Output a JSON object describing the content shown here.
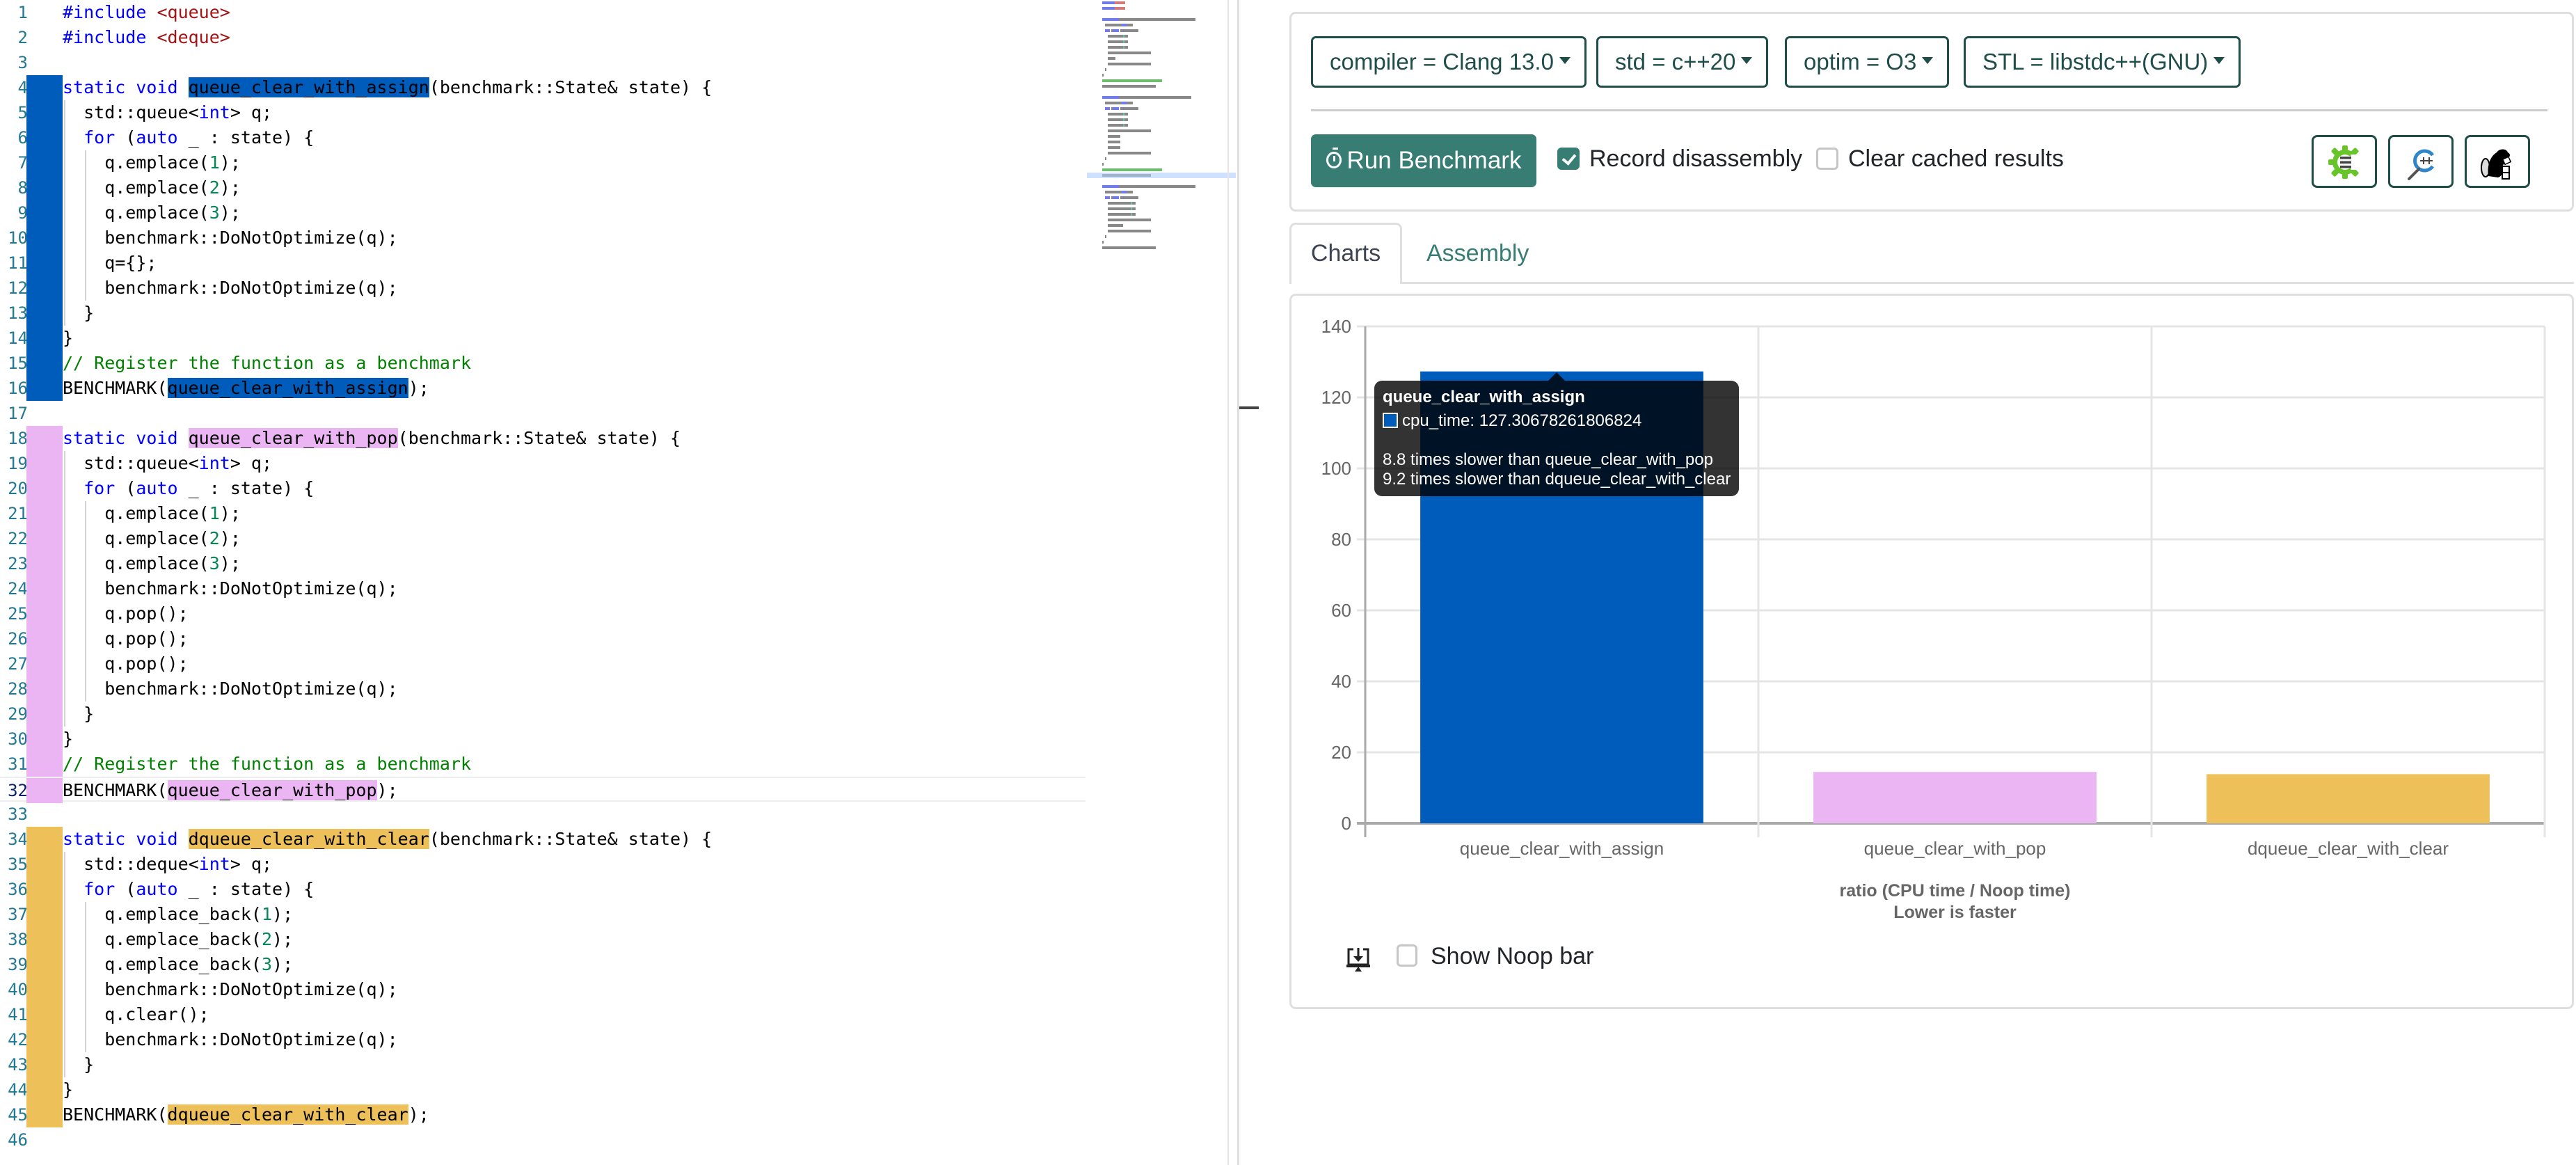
{
  "editor": {
    "lines": [
      {
        "n": 1,
        "tokens": [
          {
            "t": "#include ",
            "c": "kw"
          },
          {
            "t": "<queue>",
            "c": "str"
          }
        ]
      },
      {
        "n": 2,
        "tokens": [
          {
            "t": "#include ",
            "c": "kw"
          },
          {
            "t": "<deque>",
            "c": "str"
          }
        ]
      },
      {
        "n": 3,
        "tokens": []
      },
      {
        "n": 4,
        "group": "blue",
        "tokens": [
          {
            "t": "static void ",
            "c": "kw"
          },
          {
            "t": "queue_clear_with_assign",
            "c": "hl-blue"
          },
          {
            "t": "(benchmark::State& state) {"
          }
        ]
      },
      {
        "n": 5,
        "group": "blue",
        "tokens": [
          {
            "t": "  std::queue<"
          },
          {
            "t": "int",
            "c": "kw"
          },
          {
            "t": "> q;"
          }
        ]
      },
      {
        "n": 6,
        "group": "blue",
        "tokens": [
          {
            "t": "  "
          },
          {
            "t": "for",
            "c": "kw"
          },
          {
            "t": " ("
          },
          {
            "t": "auto",
            "c": "kw"
          },
          {
            "t": " _ : state) {"
          }
        ]
      },
      {
        "n": 7,
        "group": "blue",
        "tokens": [
          {
            "t": "    q.emplace("
          },
          {
            "t": "1",
            "c": "num"
          },
          {
            "t": ");"
          }
        ]
      },
      {
        "n": 8,
        "group": "blue",
        "tokens": [
          {
            "t": "    q.emplace("
          },
          {
            "t": "2",
            "c": "num"
          },
          {
            "t": ");"
          }
        ]
      },
      {
        "n": 9,
        "group": "blue",
        "tokens": [
          {
            "t": "    q.emplace("
          },
          {
            "t": "3",
            "c": "num"
          },
          {
            "t": ");"
          }
        ]
      },
      {
        "n": 10,
        "group": "blue",
        "tokens": [
          {
            "t": "    benchmark::DoNotOptimize(q);"
          }
        ]
      },
      {
        "n": 11,
        "group": "blue",
        "tokens": [
          {
            "t": "    q={};"
          }
        ]
      },
      {
        "n": 12,
        "group": "blue",
        "tokens": [
          {
            "t": "    benchmark::DoNotOptimize(q);"
          }
        ]
      },
      {
        "n": 13,
        "group": "blue",
        "tokens": [
          {
            "t": "  }"
          }
        ]
      },
      {
        "n": 14,
        "group": "blue",
        "tokens": [
          {
            "t": "}"
          }
        ]
      },
      {
        "n": 15,
        "group": "blue",
        "tokens": [
          {
            "t": "// Register the function as a benchmark",
            "c": "cm"
          }
        ]
      },
      {
        "n": 16,
        "group": "blue",
        "tokens": [
          {
            "t": "BENCHMARK("
          },
          {
            "t": "queue_clear_with_assign",
            "c": "hl-blue"
          },
          {
            "t": ");"
          }
        ]
      },
      {
        "n": 17,
        "tokens": []
      },
      {
        "n": 18,
        "group": "pink",
        "tokens": [
          {
            "t": "static void ",
            "c": "kw"
          },
          {
            "t": "queue_clear_with_pop",
            "c": "hl-pink"
          },
          {
            "t": "(benchmark::State& state) {"
          }
        ]
      },
      {
        "n": 19,
        "group": "pink",
        "tokens": [
          {
            "t": "  std::queue<"
          },
          {
            "t": "int",
            "c": "kw"
          },
          {
            "t": "> q;"
          }
        ]
      },
      {
        "n": 20,
        "group": "pink",
        "tokens": [
          {
            "t": "  "
          },
          {
            "t": "for",
            "c": "kw"
          },
          {
            "t": " ("
          },
          {
            "t": "auto",
            "c": "kw"
          },
          {
            "t": " _ : state) {"
          }
        ]
      },
      {
        "n": 21,
        "group": "pink",
        "tokens": [
          {
            "t": "    q.emplace("
          },
          {
            "t": "1",
            "c": "num"
          },
          {
            "t": ");"
          }
        ]
      },
      {
        "n": 22,
        "group": "pink",
        "tokens": [
          {
            "t": "    q.emplace("
          },
          {
            "t": "2",
            "c": "num"
          },
          {
            "t": ");"
          }
        ]
      },
      {
        "n": 23,
        "group": "pink",
        "tokens": [
          {
            "t": "    q.emplace("
          },
          {
            "t": "3",
            "c": "num"
          },
          {
            "t": ");"
          }
        ]
      },
      {
        "n": 24,
        "group": "pink",
        "tokens": [
          {
            "t": "    benchmark::DoNotOptimize(q);"
          }
        ]
      },
      {
        "n": 25,
        "group": "pink",
        "tokens": [
          {
            "t": "    q.pop();"
          }
        ]
      },
      {
        "n": 26,
        "group": "pink",
        "tokens": [
          {
            "t": "    q.pop();"
          }
        ]
      },
      {
        "n": 27,
        "group": "pink",
        "tokens": [
          {
            "t": "    q.pop();"
          }
        ]
      },
      {
        "n": 28,
        "group": "pink",
        "tokens": [
          {
            "t": "    benchmark::DoNotOptimize(q);"
          }
        ]
      },
      {
        "n": 29,
        "group": "pink",
        "tokens": [
          {
            "t": "  }"
          }
        ]
      },
      {
        "n": 30,
        "group": "pink",
        "tokens": [
          {
            "t": "}"
          }
        ]
      },
      {
        "n": 31,
        "group": "pink",
        "tokens": [
          {
            "t": "// Register the function as a benchmark",
            "c": "cm"
          }
        ]
      },
      {
        "n": 32,
        "group": "pink",
        "current": true,
        "tokens": [
          {
            "t": "BENCHMARK("
          },
          {
            "t": "queue_clear_with_pop",
            "c": "hl-pink"
          },
          {
            "t": ");"
          }
        ]
      },
      {
        "n": 33,
        "tokens": []
      },
      {
        "n": 34,
        "group": "gold",
        "tokens": [
          {
            "t": "static void ",
            "c": "kw"
          },
          {
            "t": "dqueue_clear_with_clear",
            "c": "hl-gold"
          },
          {
            "t": "(benchmark::State& state) {"
          }
        ]
      },
      {
        "n": 35,
        "group": "gold",
        "tokens": [
          {
            "t": "  std::deque<"
          },
          {
            "t": "int",
            "c": "kw"
          },
          {
            "t": "> q;"
          }
        ]
      },
      {
        "n": 36,
        "group": "gold",
        "tokens": [
          {
            "t": "  "
          },
          {
            "t": "for",
            "c": "kw"
          },
          {
            "t": " ("
          },
          {
            "t": "auto",
            "c": "kw"
          },
          {
            "t": " _ : state) {"
          }
        ]
      },
      {
        "n": 37,
        "group": "gold",
        "tokens": [
          {
            "t": "    q.emplace_back("
          },
          {
            "t": "1",
            "c": "num"
          },
          {
            "t": ");"
          }
        ]
      },
      {
        "n": 38,
        "group": "gold",
        "tokens": [
          {
            "t": "    q.emplace_back("
          },
          {
            "t": "2",
            "c": "num"
          },
          {
            "t": ");"
          }
        ]
      },
      {
        "n": 39,
        "group": "gold",
        "tokens": [
          {
            "t": "    q.emplace_back("
          },
          {
            "t": "3",
            "c": "num"
          },
          {
            "t": ");"
          }
        ]
      },
      {
        "n": 40,
        "group": "gold",
        "tokens": [
          {
            "t": "    benchmark::DoNotOptimize(q);"
          }
        ]
      },
      {
        "n": 41,
        "group": "gold",
        "tokens": [
          {
            "t": "    q.clear();"
          }
        ]
      },
      {
        "n": 42,
        "group": "gold",
        "tokens": [
          {
            "t": "    benchmark::DoNotOptimize(q);"
          }
        ]
      },
      {
        "n": 43,
        "group": "gold",
        "tokens": [
          {
            "t": "  }"
          }
        ]
      },
      {
        "n": 44,
        "group": "gold",
        "tokens": [
          {
            "t": "}"
          }
        ]
      },
      {
        "n": 45,
        "group": "gold",
        "tokens": [
          {
            "t": "BENCHMARK("
          },
          {
            "t": "dqueue_clear_with_clear",
            "c": "hl-gold"
          },
          {
            "t": ");"
          }
        ]
      },
      {
        "n": 46,
        "tokens": []
      }
    ],
    "group_colors": {
      "blue": "#005cbb",
      "pink": "#ebb5f3",
      "gold": "#edc05a"
    }
  },
  "toolbar": {
    "dropdowns": [
      {
        "label": "compiler = Clang 13.0"
      },
      {
        "label": "std = c++20"
      },
      {
        "label": "optim = O3"
      },
      {
        "label": "STL = libstdc++(GNU)"
      }
    ],
    "run_label": "Run Benchmark",
    "record_disassembly": {
      "label": "Record disassembly",
      "checked": true
    },
    "clear_cache": {
      "label": "Clear cached results",
      "checked": false
    },
    "tools": [
      {
        "name": "compiler-explorer-icon"
      },
      {
        "name": "cpp-insights-icon"
      },
      {
        "name": "build-bench-icon"
      }
    ],
    "accent": "#377d73"
  },
  "tabs": [
    {
      "label": "Charts",
      "active": true
    },
    {
      "label": "Assembly",
      "active": false
    }
  ],
  "tooltip": {
    "title": "queue_clear_with_assign",
    "value_line": "cpu_time: 127.30678261806824",
    "compare": [
      "8.8 times slower than queue_clear_with_pop",
      "9.2 times slower than dqueue_clear_with_clear"
    ]
  },
  "chart_data": {
    "type": "bar",
    "categories": [
      "queue_clear_with_assign",
      "queue_clear_with_pop",
      "dqueue_clear_with_clear"
    ],
    "values": [
      127.31,
      14.47,
      13.84
    ],
    "colors": [
      "#005cbb",
      "#ebb5f3",
      "#edc05a"
    ],
    "title": "",
    "xlabel": "ratio (CPU time / Noop time)",
    "xlabel2": "Lower is faster",
    "ylabel": "",
    "ylim": [
      0,
      140
    ],
    "yticks": [
      0,
      20,
      40,
      60,
      80,
      100,
      120,
      140
    ],
    "grid": true,
    "legend": "none"
  },
  "footer": {
    "show_noop": {
      "label": "Show Noop bar",
      "checked": false
    }
  }
}
